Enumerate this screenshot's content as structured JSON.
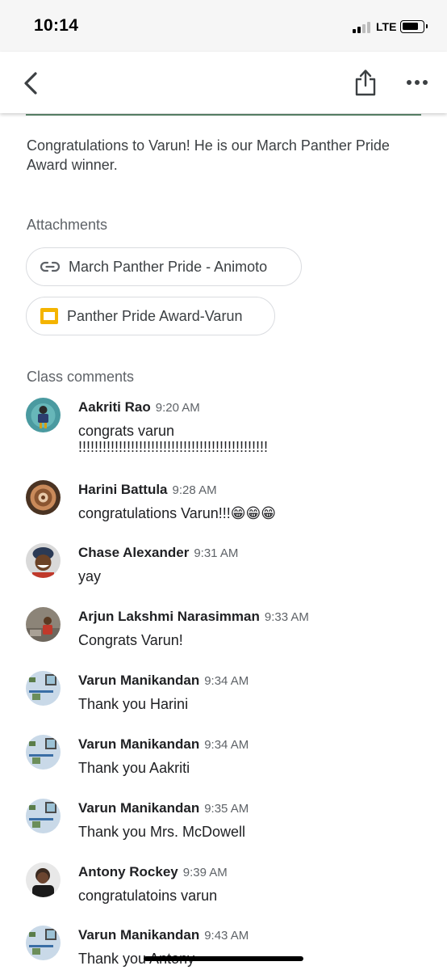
{
  "status_bar": {
    "time": "10:14",
    "network": "LTE"
  },
  "post": {
    "text": "Congratulations to Varun!  He is our March Panther Pride Award winner."
  },
  "attachments": {
    "label": "Attachments",
    "items": [
      {
        "label": "March Panther Pride - Animoto",
        "icon": "link-icon"
      },
      {
        "label": "Panther Pride Award-Varun",
        "icon": "slides-icon"
      }
    ]
  },
  "comments": {
    "label": "Class comments",
    "items": [
      {
        "name": "Aakriti Rao",
        "time": "9:20 AM",
        "text": "congrats varun !!!!!!!!!!!!!!!!!!!!!!!!!!!!!!!!!!!!!!!!!!!!!!!"
      },
      {
        "name": "Harini Battula",
        "time": "9:28 AM",
        "text": "congratulations Varun!!!😁😁😁"
      },
      {
        "name": "Chase Alexander",
        "time": "9:31 AM",
        "text": "yay"
      },
      {
        "name": "Arjun Lakshmi Narasimman",
        "time": "9:33 AM",
        "text": "Congrats Varun!"
      },
      {
        "name": "Varun Manikandan",
        "time": "9:34 AM",
        "text": "Thank you Harini"
      },
      {
        "name": "Varun Manikandan",
        "time": "9:34 AM",
        "text": "Thank you Aakriti"
      },
      {
        "name": "Varun Manikandan",
        "time": "9:35 AM",
        "text": "Thank you Mrs. McDowell"
      },
      {
        "name": "Antony Rockey",
        "time": "9:39 AM",
        "text": "congratulatoins varun"
      },
      {
        "name": "Varun Manikandan",
        "time": "9:43 AM",
        "text": "Thank you Antony"
      }
    ]
  }
}
